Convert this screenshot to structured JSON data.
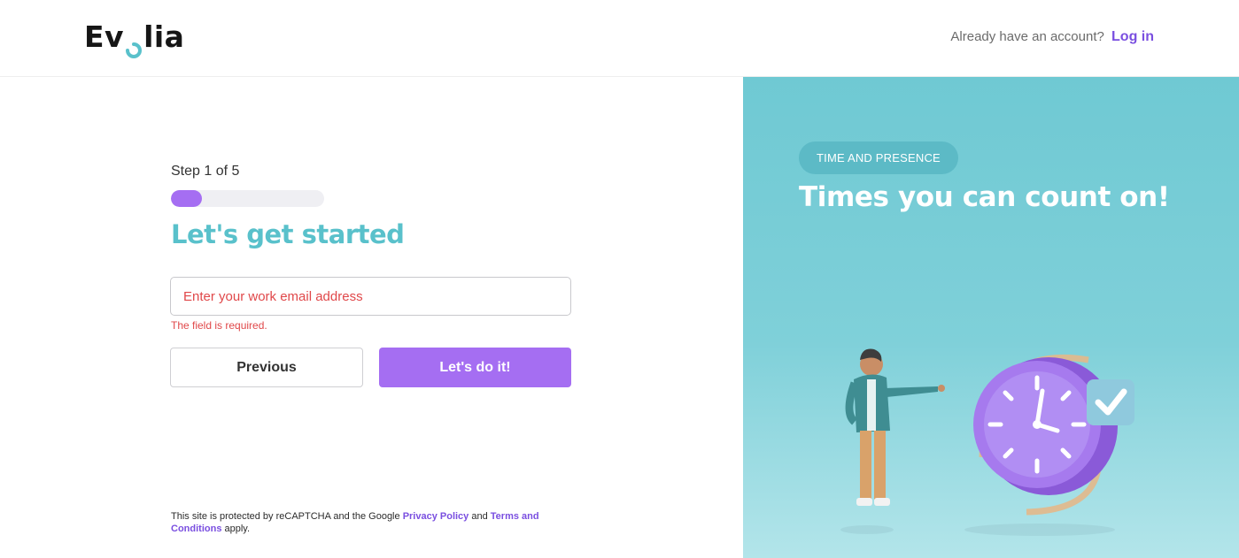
{
  "header": {
    "logo_text_left": "Ev",
    "logo_text_right": "lia",
    "account_prompt": "Already have an account?",
    "login_label": "Log in"
  },
  "form": {
    "step_text": "Step 1 of 5",
    "progress_fraction": 0.2,
    "heading": "Let's get started",
    "email_placeholder": "Enter your work email address",
    "email_value": "",
    "error_text": "The field is required.",
    "previous_label": "Previous",
    "next_label": "Let's do it!"
  },
  "recaptcha": {
    "prefix": "This site is protected by reCAPTCHA and the Google",
    "privacy_label": "Privacy Policy",
    "and_text": "and",
    "terms_label": "Terms and Conditions",
    "suffix": "apply."
  },
  "promo": {
    "pill_label": "TIME AND PRESENCE",
    "tagline": "Times you can count on!",
    "illustration": "person-pointing-at-clock"
  },
  "colors": {
    "accent_purple": "#a56ef2",
    "heading_teal": "#59c1cb",
    "error_red": "#e0484a",
    "panel_teal": "#6fc9d3"
  }
}
